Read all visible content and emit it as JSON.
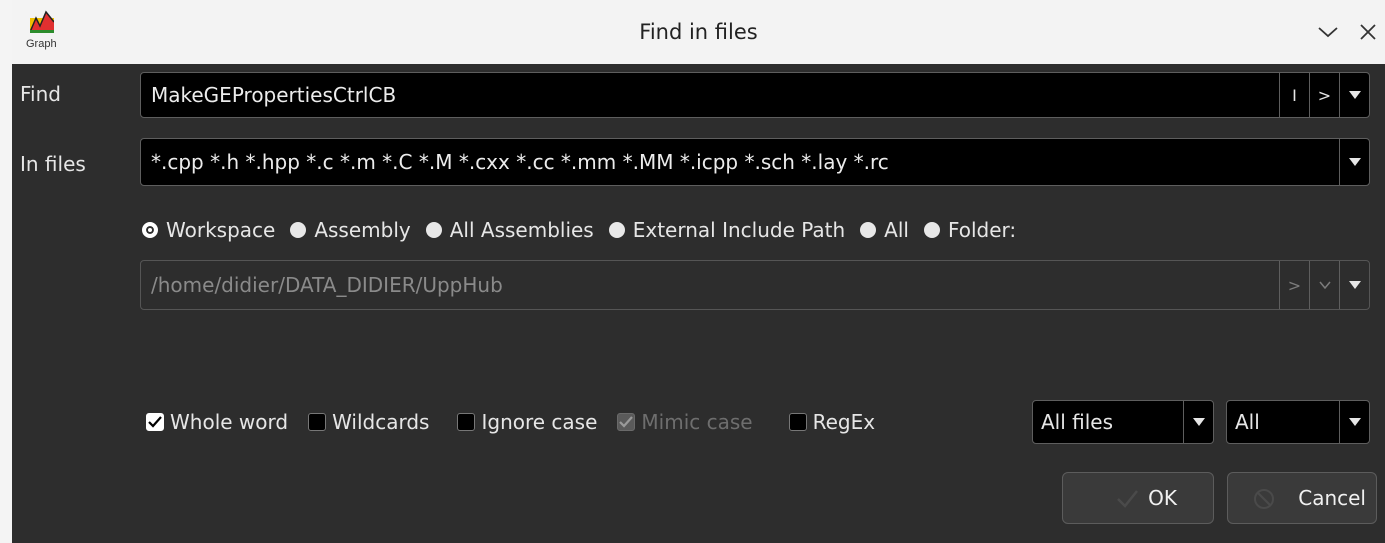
{
  "window": {
    "title": "Find in files",
    "app_icon": "graph-icon",
    "app_icon_text": "Graph",
    "controls": [
      "chevron-down-icon",
      "close-icon"
    ]
  },
  "find": {
    "label": "Find",
    "value": "MakeGEPropertiesCtrlCB",
    "buttons": [
      "I",
      ">",
      "▾"
    ]
  },
  "files": {
    "label": "In files",
    "value": "*.cpp *.h *.hpp *.c *.m *.C *.M *.cxx *.cc *.mm *.MM *.icpp *.sch *.lay *.rc"
  },
  "scope": {
    "options": [
      "Workspace",
      "Assembly",
      "All Assemblies",
      "External Include Path",
      "All",
      "Folder:"
    ],
    "selected": "Workspace"
  },
  "folder": {
    "value": "/home/didier/DATA_DIDIER/UppHub",
    "enabled": false
  },
  "options": {
    "whole_word": {
      "label": "Whole word",
      "checked": true
    },
    "wildcards": {
      "label": "Wildcards",
      "checked": false
    },
    "ignore_case": {
      "label": "Ignore case",
      "checked": false
    },
    "mimic_case": {
      "label": "Mimic case",
      "checked": true,
      "disabled": true
    },
    "regex": {
      "label": "RegEx",
      "checked": false
    }
  },
  "filter_combo": {
    "value": "All files"
  },
  "scope_combo": {
    "value": "All"
  },
  "buttons": {
    "ok": "OK",
    "cancel": "Cancel"
  },
  "colors": {
    "background": "#2d2d2d",
    "field": "#000000",
    "titlebar": "#f3f3f3"
  }
}
